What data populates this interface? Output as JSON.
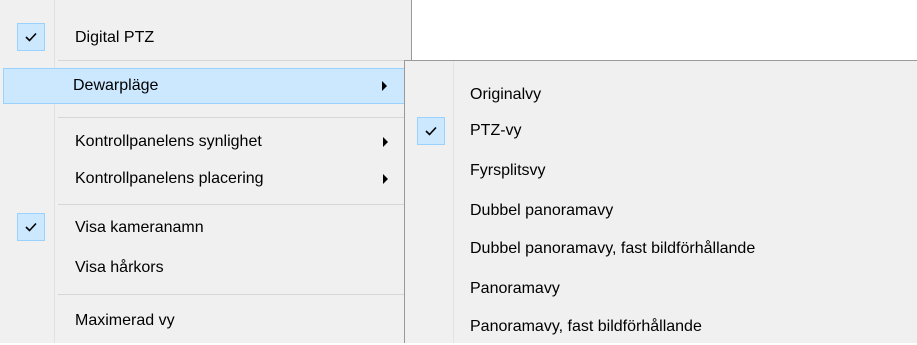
{
  "main_menu": {
    "items": [
      {
        "label": "Digital PTZ",
        "checked": true,
        "has_submenu": false,
        "highlighted": false
      },
      {
        "label": "Dewarpläge",
        "checked": false,
        "has_submenu": true,
        "highlighted": true
      },
      {
        "label": "Kontrollpanelens synlighet",
        "checked": false,
        "has_submenu": true,
        "highlighted": false
      },
      {
        "label": "Kontrollpanelens placering",
        "checked": false,
        "has_submenu": true,
        "highlighted": false
      },
      {
        "label": "Visa kameranamn",
        "checked": true,
        "has_submenu": false,
        "highlighted": false
      },
      {
        "label": "Visa hårkors",
        "checked": false,
        "has_submenu": false,
        "highlighted": false
      },
      {
        "label": "Maximerad vy",
        "checked": false,
        "has_submenu": false,
        "highlighted": false
      }
    ]
  },
  "submenu": {
    "items": [
      {
        "label": "Originalvy",
        "checked": false
      },
      {
        "label": "PTZ-vy",
        "checked": true
      },
      {
        "label": "Fyrsplitsvy",
        "checked": false
      },
      {
        "label": "Dubbel panoramavy",
        "checked": false
      },
      {
        "label": "Dubbel panoramavy, fast bildförhållande",
        "checked": false
      },
      {
        "label": "Panoramavy",
        "checked": false
      },
      {
        "label": "Panoramavy, fast bildförhållande",
        "checked": false
      }
    ]
  },
  "colors": {
    "menu_bg": "#f0f0f0",
    "highlight_bg": "#cce8ff",
    "highlight_border": "#99d1ff",
    "separator": "#d7d7d7"
  },
  "icons": {
    "check": "check-icon",
    "submenu_arrow": "submenu-arrow-icon"
  }
}
